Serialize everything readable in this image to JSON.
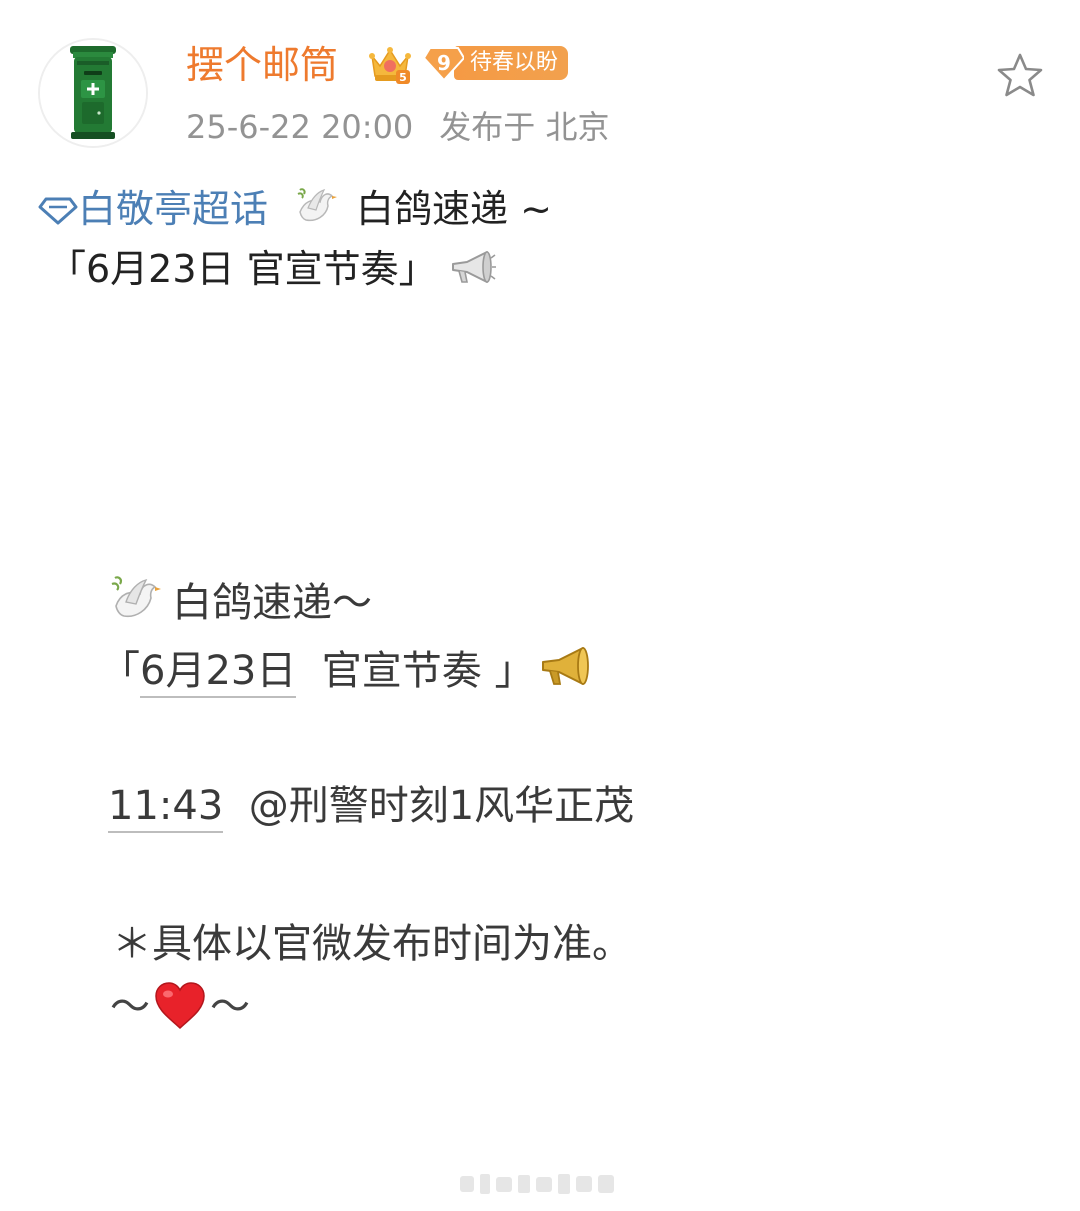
{
  "author": {
    "name": "摆个邮筒",
    "crown_level": "5",
    "fan_level": "9",
    "fan_badge_text": "待春以盼"
  },
  "post_meta": {
    "date": "25-6-22 20:00",
    "location": "发布于 北京"
  },
  "post": {
    "topic": "白敬亭超话",
    "line1_text": "白鸽速递 ~",
    "line2_text": "「6月23日 官宣节奏」"
  },
  "image_text": {
    "title": "白鸽速递～",
    "bracket_open": "「",
    "date": "6月23日",
    "rhythm": "官宣节奏",
    "bracket_close": "」",
    "time": "11:43",
    "mention": "@刑警时刻1风华正茂",
    "note": "＊具体以官微发布时间为准。",
    "tilde": "～"
  },
  "colors": {
    "username": "#ee7a2e",
    "topic_link": "#4c7fb5",
    "meta": "#939393",
    "badge": "#f59a44",
    "avatar_mailbox": "#1f6b2e"
  },
  "icons": {
    "avatar": "green-mailbox",
    "crown": "crown-icon",
    "fan_badge": "diamond-badge-icon",
    "favorite": "star-icon",
    "topic": "gem-icon",
    "dove": "dove-emoji",
    "megaphone": "megaphone-emoji",
    "heart": "red-heart-emoji"
  }
}
